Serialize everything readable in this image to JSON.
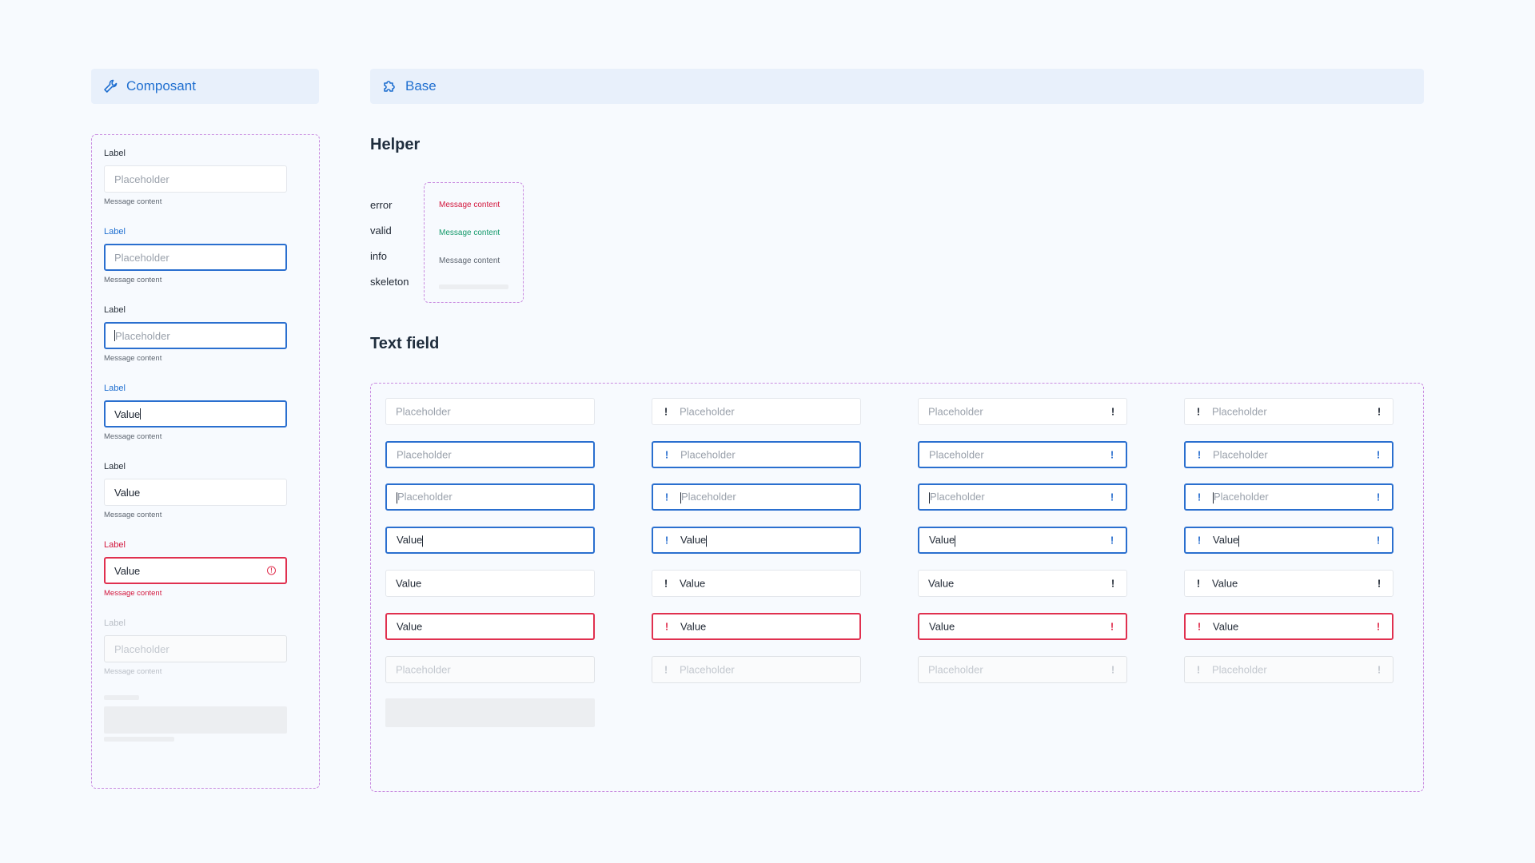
{
  "tabs": {
    "composant": "Composant",
    "base": "Base"
  },
  "composant": {
    "groups": [
      {
        "label": "Label",
        "placeholder": "Placeholder",
        "message": "Message content"
      },
      {
        "label": "Label",
        "placeholder": "Placeholder",
        "message": "Message content"
      },
      {
        "label": "Label",
        "placeholder": "Placeholder",
        "message": "Message content"
      },
      {
        "label": "Label",
        "value": "Value",
        "message": "Message content"
      },
      {
        "label": "Label",
        "value": "Value",
        "message": "Message content"
      },
      {
        "label": "Label",
        "value": "Value",
        "message": "Message content"
      },
      {
        "label": "Label",
        "placeholder": "Placeholder",
        "message": "Message content"
      }
    ]
  },
  "helper": {
    "title": "Helper",
    "names": [
      "error",
      "valid",
      "info",
      "skeleton"
    ],
    "messages": [
      "Message content",
      "Message content",
      "Message content"
    ]
  },
  "textfield": {
    "title": "Text field",
    "placeholder": "Placeholder",
    "value": "Value"
  },
  "colors": {
    "accent": "#2a6fcf",
    "error": "#e0304f",
    "valid": "#159a6b",
    "frame": "#c98be0"
  }
}
